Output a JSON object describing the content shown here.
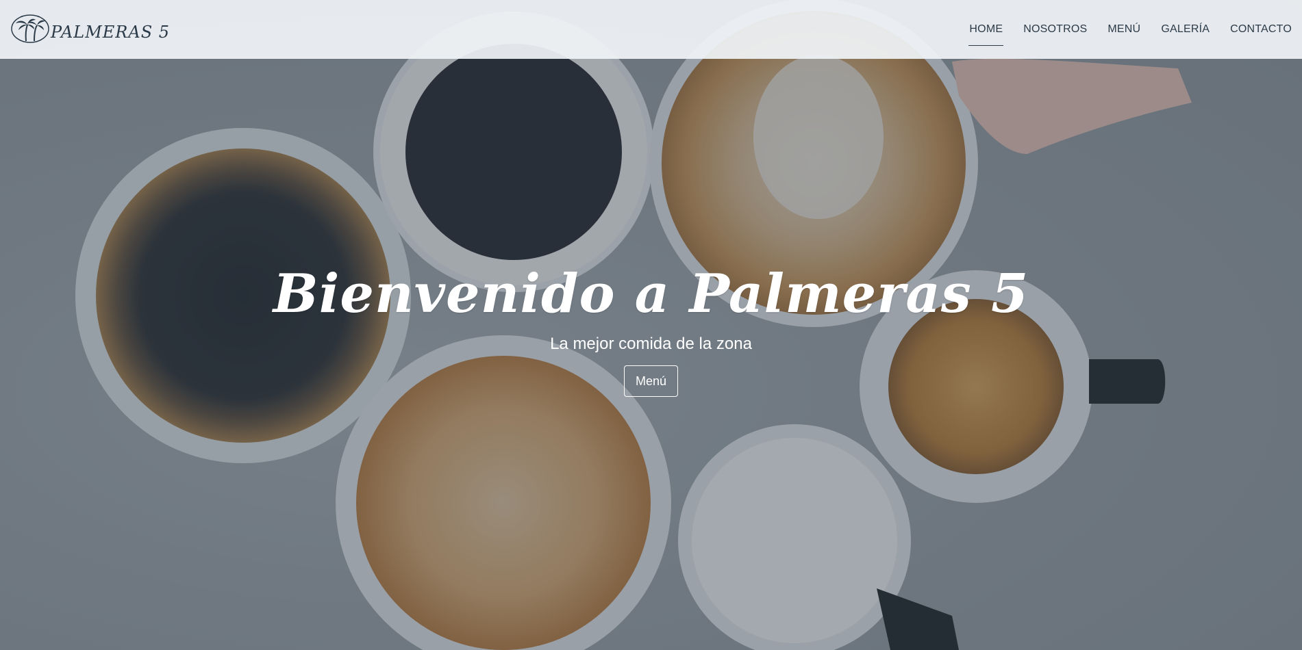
{
  "brand": {
    "name": "PALMERAS 5",
    "logo_icon": "palm-trees-icon"
  },
  "nav": {
    "items": [
      {
        "label": "HOME",
        "active": true
      },
      {
        "label": "NOSOTROS",
        "active": false
      },
      {
        "label": "MENÚ",
        "active": false
      },
      {
        "label": "GALERÍA",
        "active": false
      },
      {
        "label": "CONTACTO",
        "active": false
      }
    ]
  },
  "hero": {
    "title": "Bienvenido a Palmeras 5",
    "subtitle": "La mejor comida de la zona",
    "button_label": "Menú",
    "background": "coffee-cups-photo"
  },
  "colors": {
    "navbar_bg": "#f0f3f6",
    "nav_text": "#2c3a47",
    "overlay": "#34404e",
    "hero_text": "#ffffff"
  }
}
